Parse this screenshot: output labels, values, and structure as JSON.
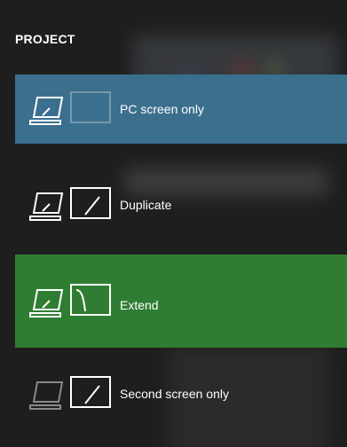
{
  "flyout": {
    "title": "PROJECT",
    "options": [
      {
        "label": "PC screen only",
        "icon": "pc-screen-only-icon",
        "background": "#3b6f8e"
      },
      {
        "label": "Duplicate",
        "icon": "duplicate-icon"
      },
      {
        "label": "Extend",
        "icon": "extend-icon",
        "background": "#2f7d32",
        "selected": true
      },
      {
        "label": "Second screen only",
        "icon": "second-screen-only-icon"
      }
    ]
  },
  "colors": {
    "panel_background": "#1e1e1e",
    "hover_blue": "#3b6f8e",
    "selected_green": "#2f7d32",
    "text": "#ffffff"
  }
}
